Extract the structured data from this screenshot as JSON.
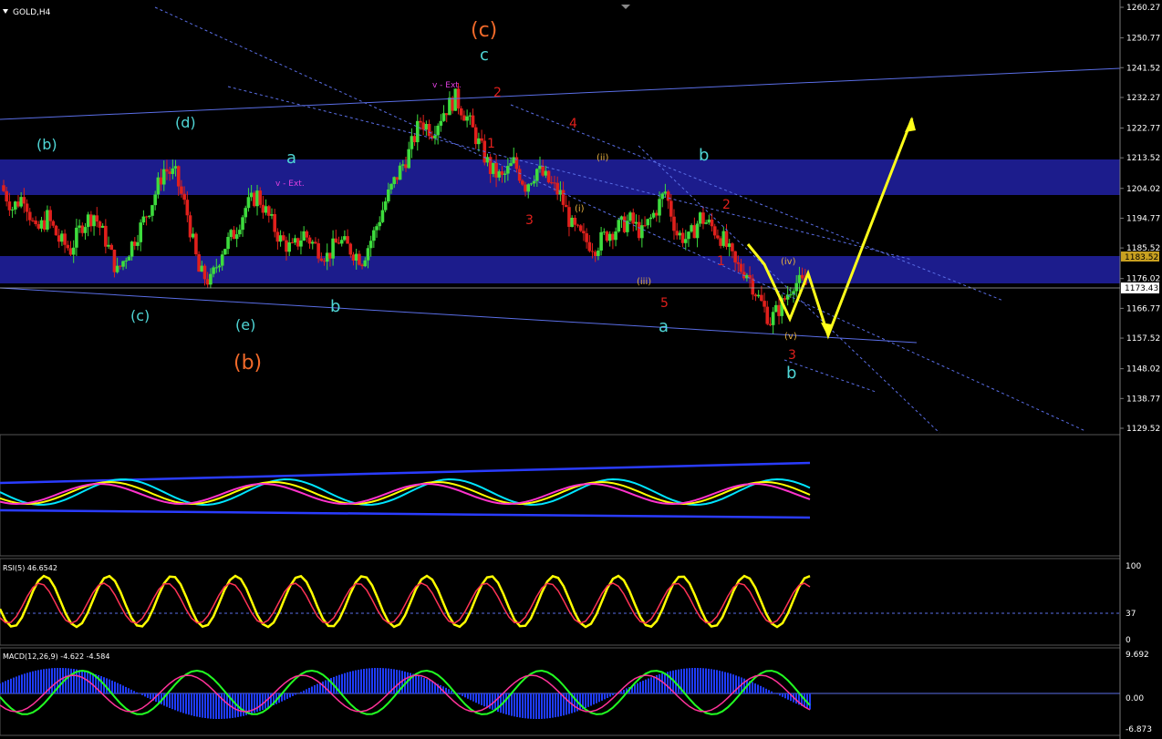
{
  "symbol_label": "GOLD,H4",
  "colors": {
    "background": "#000000",
    "bull_candle": "#3ddc3d",
    "bear_candle": "#e0201c",
    "zone": "#1c1c8c",
    "channel_line": "#5a6ee6",
    "projection": "#ffff1a",
    "wave_cyan": "#4fd6d6",
    "wave_orange": "#f26a2a",
    "wave_red": "#e0201c",
    "wave_magenta": "#e040e0",
    "wave_yellow": "#e6b040"
  },
  "price_axis": {
    "ticks": [
      "1260.27",
      "1250.77",
      "1241.52",
      "1232.27",
      "1222.77",
      "1213.52",
      "1204.02",
      "1194.77",
      "1185.52",
      "1176.02",
      "1166.77",
      "1157.52",
      "1148.02",
      "1138.77",
      "1129.52"
    ],
    "current_price": "1173.43",
    "zone_price": "1183.52"
  },
  "wave_labels": {
    "main": [
      "(c)",
      "(b)"
    ],
    "primary": [
      "(b)",
      "(d)",
      "(c)",
      "(e)"
    ],
    "abc": [
      "a",
      "b",
      "c",
      "b",
      "a",
      "b",
      "c",
      "c"
    ],
    "ext": [
      "v - Ext.",
      "v - Ext."
    ],
    "numbers": [
      "1",
      "2",
      "3",
      "4",
      "5",
      "1",
      "2",
      "3"
    ],
    "roman": [
      "(i)",
      "(ii)",
      "(iii)",
      "(iv)",
      "(v)"
    ]
  },
  "indicators": {
    "rsi": {
      "label": "RSI(5) 46.6542",
      "levels": [
        "100",
        "37",
        "0"
      ]
    },
    "macd": {
      "label": "MACD(12,26,9) -4.622 -4.584",
      "levels": [
        "9.692",
        "0.00",
        "-6.873"
      ]
    }
  },
  "chart_data": {
    "type": "candlestick",
    "symbol": "GOLD",
    "timeframe": "H4",
    "y_range": [
      1129.52,
      1260.27
    ],
    "y_ticks": [
      1260.27,
      1250.77,
      1241.52,
      1232.27,
      1222.77,
      1213.52,
      1204.02,
      1194.77,
      1185.52,
      1176.02,
      1166.77,
      1157.52,
      1148.02,
      1138.77,
      1129.52
    ],
    "current_price": 1173.43,
    "zones": [
      [
        1203,
        1213.5
      ],
      [
        1176,
        1184
      ]
    ],
    "path": [
      1205,
      1198,
      1202,
      1190,
      1195,
      1188,
      1185,
      1193,
      1196,
      1188,
      1178,
      1185,
      1192,
      1200,
      1210,
      1208,
      1196,
      1178,
      1175,
      1185,
      1190,
      1198,
      1202,
      1195,
      1188,
      1185,
      1190,
      1186,
      1183,
      1188,
      1185,
      1182,
      1190,
      1200,
      1208,
      1215,
      1225,
      1222,
      1228,
      1232,
      1226,
      1218,
      1210,
      1207,
      1212,
      1205,
      1210,
      1206,
      1202,
      1192,
      1188,
      1186,
      1190,
      1192,
      1194,
      1190,
      1196,
      1203,
      1190,
      1188,
      1195,
      1192,
      1188,
      1180,
      1178,
      1170,
      1163,
      1168,
      1175,
      1174
    ],
    "projection": [
      [
        1182,
        1191
      ],
      [
        1185,
        1176
      ],
      [
        1176,
        1165
      ],
      [
        1178,
        1158
      ],
      [
        1208,
        1227
      ]
    ],
    "rsi": {
      "label": "RSI(5)",
      "value": 46.6542,
      "levels": [
        100,
        37,
        0
      ]
    },
    "macd": {
      "label": "MACD(12,26,9)",
      "values": [
        -4.622,
        -4.584
      ],
      "levels": [
        9.692,
        0.0,
        -6.873
      ]
    }
  }
}
